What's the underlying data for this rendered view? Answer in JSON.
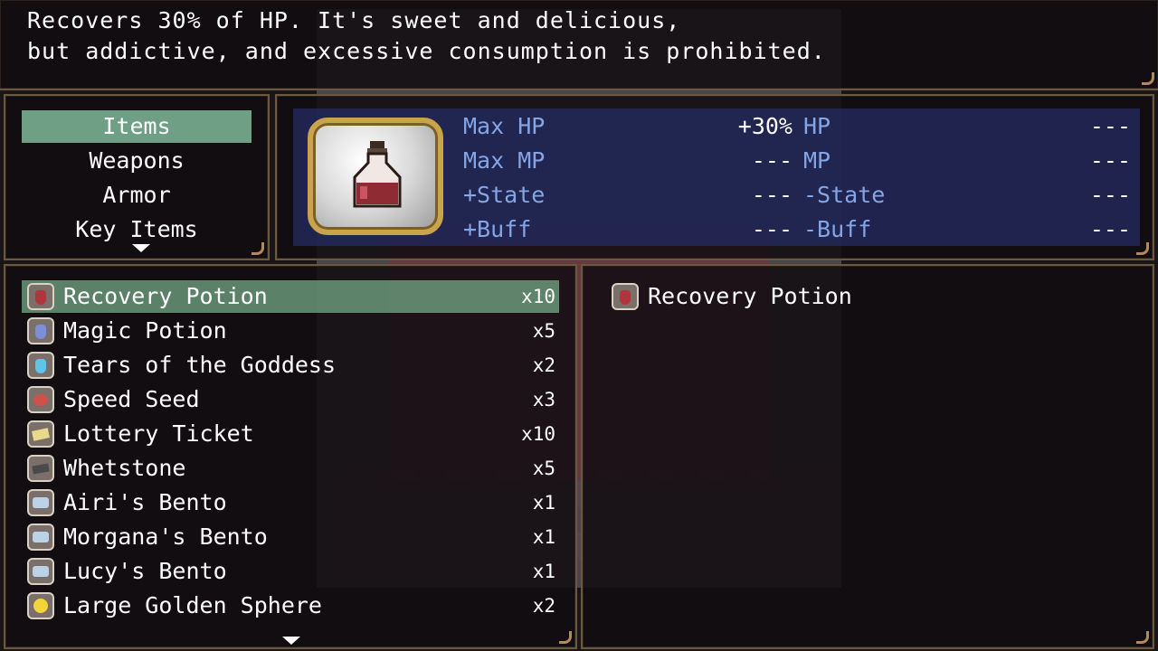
{
  "help": {
    "line1": "Recovers 30% of HP. It's sweet and delicious,",
    "line2": "but addictive, and excessive consumption is prohibited."
  },
  "categories": [
    {
      "label": "Items"
    },
    {
      "label": "Weapons"
    },
    {
      "label": "Armor"
    },
    {
      "label": "Key Items"
    }
  ],
  "status": {
    "rows": [
      {
        "label_left": "Max HP",
        "value_left": "+30%",
        "label_right": "HP",
        "value_right": "---"
      },
      {
        "label_left": "Max MP",
        "value_left": "---",
        "label_right": "MP",
        "value_right": "---"
      },
      {
        "label_left": "+State",
        "value_left": "---",
        "label_right": "-State",
        "value_right": "---"
      },
      {
        "label_left": "+Buff",
        "value_left": "---",
        "label_right": "-Buff",
        "value_right": "---"
      }
    ]
  },
  "items": [
    {
      "name": "Recovery Potion",
      "count": "x10",
      "icon": "red-potion-icon"
    },
    {
      "name": "Magic Potion",
      "count": "x5",
      "icon": "blue-potion-icon"
    },
    {
      "name": "Tears of the Goddess",
      "count": "x2",
      "icon": "light-blue-potion-icon"
    },
    {
      "name": "Speed Seed",
      "count": "x3",
      "icon": "seed-icon"
    },
    {
      "name": "Lottery Ticket",
      "count": "x10",
      "icon": "ticket-icon"
    },
    {
      "name": "Whetstone",
      "count": "x5",
      "icon": "whetstone-icon"
    },
    {
      "name": "Airi's Bento",
      "count": "x1",
      "icon": "bento-icon"
    },
    {
      "name": "Morgana's Bento",
      "count": "x1",
      "icon": "bento-icon"
    },
    {
      "name": "Lucy's Bento",
      "count": "x1",
      "icon": "bento-icon"
    },
    {
      "name": "Large Golden Sphere",
      "count": "x2",
      "icon": "golden-sphere-icon"
    }
  ],
  "detail": {
    "name": "Recovery Potion"
  },
  "colors": {
    "category_highlight": "#6fa085",
    "row_highlight": "#78af8c",
    "system_label": "#84a6e6",
    "window_border": "#b3895a"
  }
}
